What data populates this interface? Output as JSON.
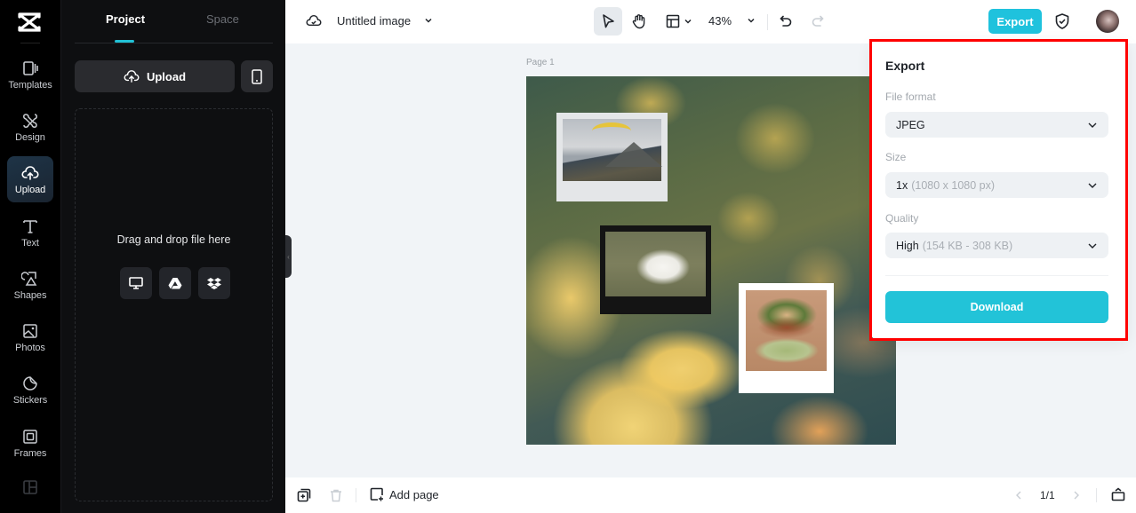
{
  "rail": {
    "items": [
      {
        "label": "Templates",
        "icon": "templates-icon"
      },
      {
        "label": "Design",
        "icon": "design-icon"
      },
      {
        "label": "Upload",
        "icon": "upload-icon",
        "active": true
      },
      {
        "label": "Text",
        "icon": "text-icon"
      },
      {
        "label": "Shapes",
        "icon": "shapes-icon"
      },
      {
        "label": "Photos",
        "icon": "photos-icon"
      },
      {
        "label": "Stickers",
        "icon": "stickers-icon"
      },
      {
        "label": "Frames",
        "icon": "frames-icon"
      }
    ]
  },
  "panel": {
    "tabs": [
      "Project",
      "Space"
    ],
    "active_tab": "Project",
    "upload_label": "Upload",
    "drop_text": "Drag and drop file here",
    "sources": [
      "computer-icon",
      "google-drive-icon",
      "dropbox-icon"
    ]
  },
  "topbar": {
    "title": "Untitled image",
    "zoom": "43%",
    "export_label": "Export"
  },
  "canvas": {
    "page_label": "Page 1"
  },
  "bottombar": {
    "add_page_label": "Add page",
    "page_count": "1/1"
  },
  "export_panel": {
    "title": "Export",
    "file_format_label": "File format",
    "file_format_value": "JPEG",
    "size_label": "Size",
    "size_value": "1x",
    "size_detail": "(1080 x 1080 px)",
    "quality_label": "Quality",
    "quality_value": "High",
    "quality_detail": "(154 KB - 308 KB)",
    "download_label": "Download"
  },
  "colors": {
    "accent": "#1fc2dd",
    "highlight": "#ff0000",
    "rail_bg": "#000000",
    "panel_bg": "#0e0f11"
  }
}
